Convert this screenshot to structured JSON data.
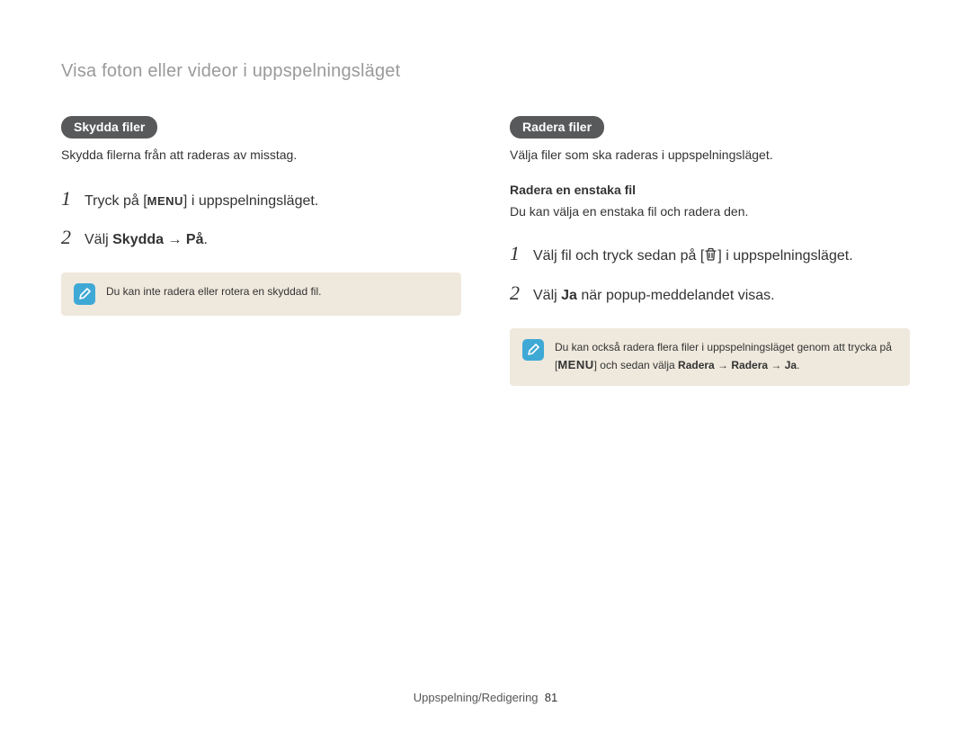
{
  "breadcrumb": "Visa foton eller videor i uppspelningsläget",
  "left": {
    "pill": "Skydda filer",
    "intro": "Skydda filerna från att raderas av misstag.",
    "step1_pre": "Tryck på [",
    "step1_menu": "MENU",
    "step1_post": "] i uppspelningsläget.",
    "step2_pre": "Välj ",
    "step2_bold": "Skydda → På",
    "step2_post": ".",
    "note": "Du kan inte radera eller rotera en skyddad fil."
  },
  "right": {
    "pill": "Radera filer",
    "intro": "Välja filer som ska raderas i uppspelningsläget.",
    "subhead": "Radera en enstaka fil",
    "subtext": "Du kan välja en enstaka fil och radera den.",
    "step1_pre": "Välj fil och tryck sedan på [",
    "step1_post": "] i uppspelningsläget.",
    "step2_pre": "Välj ",
    "step2_bold": "Ja",
    "step2_post": " när popup-meddelandet visas.",
    "note_pre": "Du kan också radera flera filer i uppspelningsläget genom att trycka på [",
    "note_menu": "MENU",
    "note_mid": "] och sedan välja ",
    "note_bold": "Radera → Radera → Ja",
    "note_post": "."
  },
  "footer_label": "Uppspelning/Redigering",
  "footer_page": "81"
}
